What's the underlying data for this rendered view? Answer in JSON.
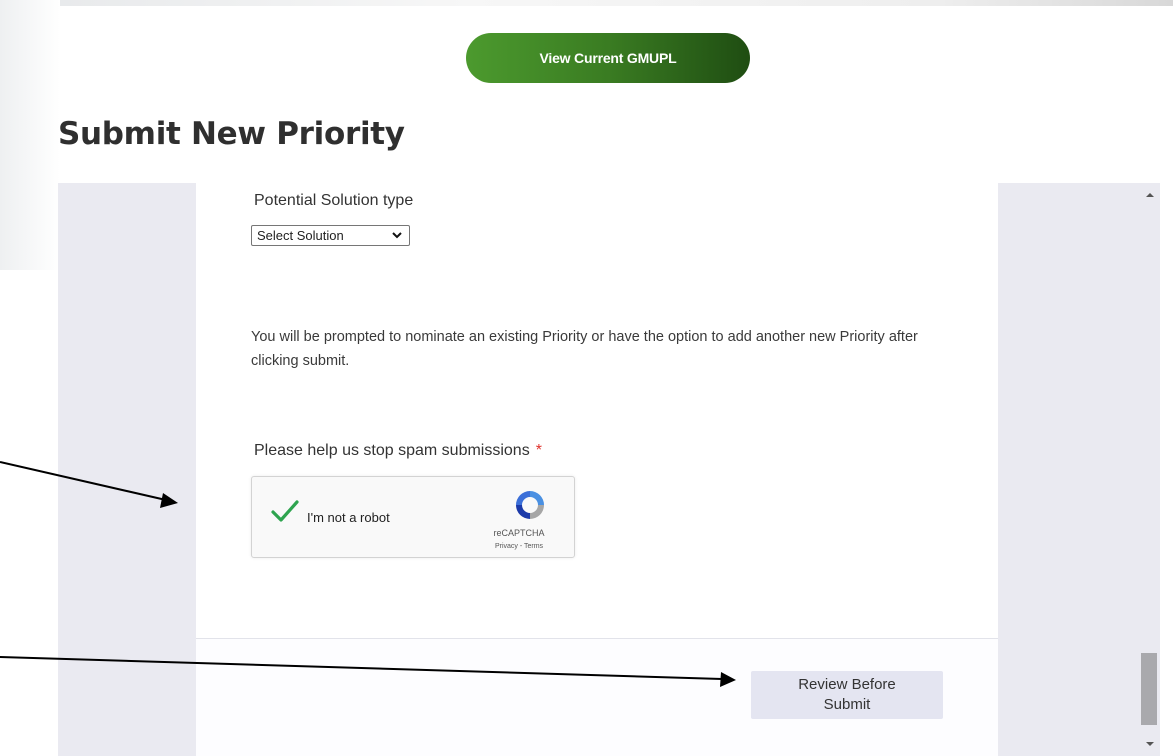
{
  "header": {
    "view_button_label": "View Current GMUPL",
    "page_title": "Submit New Priority"
  },
  "form": {
    "solution_type_label": "Potential Solution type",
    "solution_select_value": "Select Solution",
    "info_text": "You will be prompted to nominate an existing Priority or have the option to add another new Priority after clicking submit.",
    "spam_label": "Please help us stop spam submissions",
    "required_marker": "*",
    "captcha": {
      "checkbox_label": "I'm not a robot",
      "brand": "reCAPTCHA",
      "privacy": "Privacy",
      "separator": " - ",
      "terms": "Terms",
      "checked": true
    },
    "review_button_label": "Review Before Submit"
  },
  "colors": {
    "button_green_start": "#4c9a2e",
    "button_green_end": "#1f4d12",
    "required": "#e0322d",
    "checkmark": "#2ea44f"
  },
  "icons": {
    "select_chevron": "chevron-down-icon",
    "captcha_check": "checkmark-icon",
    "captcha_logo": "recaptcha-logo-icon",
    "scroll_up": "scroll-up-arrow-icon",
    "scroll_down": "scroll-down-arrow-icon",
    "annotation_arrows": "arrow-icon"
  }
}
